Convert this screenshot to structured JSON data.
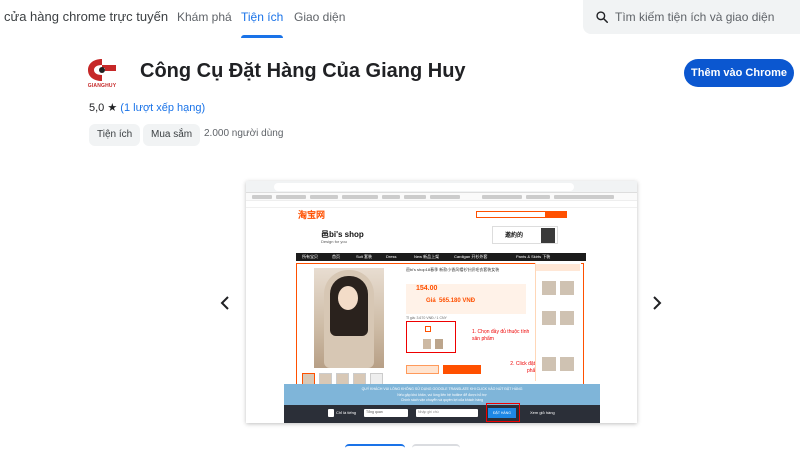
{
  "header": {
    "brand": "cửa hàng chrome trực tuyến",
    "nav": [
      {
        "label": "Khám phá"
      },
      {
        "label": "Tiện ích"
      },
      {
        "label": "Giao diện"
      }
    ],
    "active_tab": "Tiện ích",
    "search_placeholder": "Tìm kiếm tiện ích và giao diện"
  },
  "extension": {
    "logo_text": "GIANGHUY",
    "title": "Công Cụ Đặt Hàng Của Giang Huy",
    "add_button": "Thêm vào Chrome",
    "rating": "5,0",
    "rating_count": "(1 lượt xếp hạng)",
    "category_chips": [
      "Tiện ích",
      "Mua sắm"
    ],
    "users": "2.000 người dùng"
  },
  "colors": {
    "accent": "#1a73e8",
    "button": "#0b57d0",
    "taobao_orange": "#ff5000",
    "annotation_red": "#e00000"
  },
  "carousel": {
    "prev_icon": "chevron-left-icon",
    "next_icon": "chevron-right-icon",
    "screenshot": {
      "site_logo": "淘宝网",
      "shop_name": "邑bi's shop",
      "shop_tagline": "Design for you",
      "banner_text": "邀約的",
      "nav_items": [
        "所有宝贝",
        "首页",
        "Suit 套装",
        "Dress",
        "New 新品上架",
        "Cardigan 开衫外套",
        "Pants & Skirts 下装"
      ],
      "product_title": "邑bi's shop18春季 新款小香风帽衫针织毛衣套装女装",
      "price_cny": "154.00",
      "price_vnd_label": "Giá",
      "price_vnd": "565.180 VNĐ",
      "shipping_info": "Tỉ giá: 3.670 VNĐ / 1 CNY",
      "note_1": "1. Chọn đầy đủ thuộc tính sản phẩm",
      "note_2": "2. Click đặt hàng sản phẩm vào giỏ",
      "ext_banner": "QUÝ KHÁCH VUI LÒNG KHÔNG SỬ DỤNG GOOGLE TRANSLATE KHI CLICK VÀO NÚT ĐẶT HÀNG",
      "ext_banner_2": "Nếu gặp khó khăn, vui lòng liên hệ hotline để được hỗ trợ",
      "ext_banner_3": "Chính sách vận chuyển và quyền lợi của khách hàng",
      "ctl_label": "Chỉ là tiếng",
      "ctl_select": "Tổng quan",
      "ctl_note": "Nhập ghi chú",
      "order_button": "ĐẶT HÀNG",
      "cart_link": "Xem giỏ hàng"
    }
  }
}
